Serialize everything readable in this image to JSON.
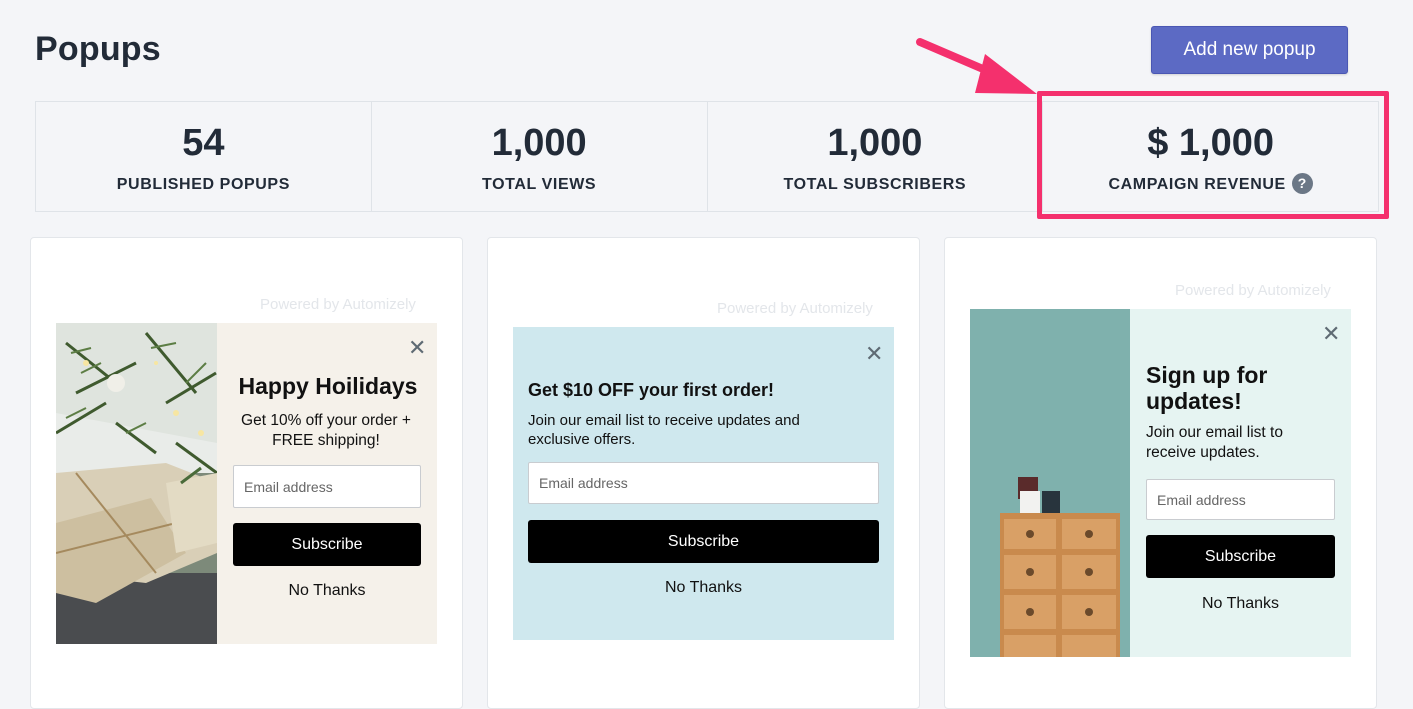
{
  "header": {
    "title": "Popups",
    "add_button": "Add new popup"
  },
  "stats": [
    {
      "value": "54",
      "label": "PUBLISHED POPUPS"
    },
    {
      "value": "1,000",
      "label": "TOTAL VIEWS"
    },
    {
      "value": "1,000",
      "label": "TOTAL SUBSCRIBERS"
    },
    {
      "value": "$ 1,000",
      "label": "CAMPAIGN REVENUE",
      "help": "?"
    }
  ],
  "colors": {
    "accent": "#5c6ac4",
    "highlight": "#f4306d",
    "popup1_bg": "#f5f1ea",
    "popup2_bg": "#cfe8ee",
    "popup3_bg": "#e6f4f2"
  },
  "cards": [
    {
      "powered": "Powered by Automizely",
      "title": "Happy Hoilidays",
      "desc": "Get 10% off your order + FREE shipping!",
      "placeholder": "Email address",
      "button": "Subscribe",
      "no_thanks": "No Thanks",
      "close": "✕",
      "image": "holiday-gifts-image"
    },
    {
      "powered": "Powered by Automizely",
      "title": "Get $10 OFF your first order!",
      "desc": "Join our email list to receive updates and exclusive offers.",
      "placeholder": "Email address",
      "button": "Subscribe",
      "no_thanks": "No Thanks",
      "close": "✕"
    },
    {
      "powered": "Powered by Automizely",
      "title": "Sign up for updates!",
      "desc": "Join our email list to receive updates.",
      "placeholder": "Email address",
      "button": "Subscribe",
      "no_thanks": "No Thanks",
      "close": "✕",
      "image": "drawer-cabinet-image"
    }
  ]
}
